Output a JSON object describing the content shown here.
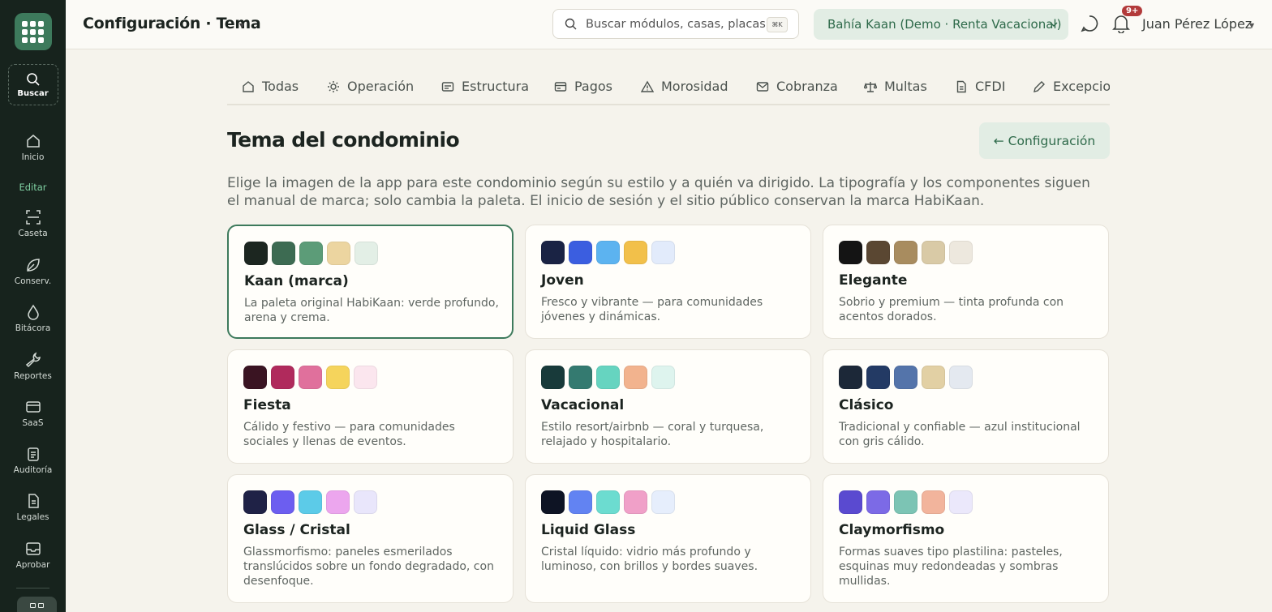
{
  "sidebar": {
    "search_label": "Buscar",
    "edit_label": "Editar",
    "items": [
      {
        "label": "Inicio",
        "icon": "home-icon"
      },
      {
        "label": "Caseta",
        "icon": "scan-icon"
      },
      {
        "label": "Conserv.",
        "icon": "leaf-icon"
      },
      {
        "label": "Bitácora",
        "icon": "drop-icon"
      },
      {
        "label": "Reportes",
        "icon": "wrench-icon"
      },
      {
        "label": "SaaS",
        "icon": "card-icon"
      },
      {
        "label": "Auditoría",
        "icon": "clipboard-icon"
      },
      {
        "label": "Legales",
        "icon": "document-icon"
      },
      {
        "label": "Aprobar",
        "icon": "inbox-icon"
      }
    ]
  },
  "header": {
    "title": "Configuración · Tema",
    "search_placeholder": "Buscar módulos, casas, placas…",
    "search_shortcut": "⌘K",
    "org_name": "Bahía Kaan (Demo · Renta Vacacional)",
    "notifications_badge": "9+",
    "user_name": "Juan Pérez López"
  },
  "tabs": [
    {
      "label": "Todas",
      "icon": "home-icon"
    },
    {
      "label": "Operación",
      "icon": "sun-icon"
    },
    {
      "label": "Estructura",
      "icon": "id-card-icon"
    },
    {
      "label": "Pagos",
      "icon": "card-icon"
    },
    {
      "label": "Morosidad",
      "icon": "warning-icon"
    },
    {
      "label": "Cobranza",
      "icon": "mail-icon"
    },
    {
      "label": "Multas",
      "icon": "scale-icon"
    },
    {
      "label": "CFDI",
      "icon": "file-icon"
    },
    {
      "label": "Excepcio",
      "icon": "pencil-icon"
    }
  ],
  "main": {
    "title": "Tema del condominio",
    "back_button": "← Configuración",
    "description": "Elige la imagen de la app para este condominio según su estilo y a quién va dirigido. La tipografía y los componentes siguen el manual de marca; solo cambia la paleta. El inicio de sesión y el sitio público conservan la marca HabiKaan."
  },
  "themes": [
    {
      "name": "Kaan (marca)",
      "description": "La paleta original HabiKaan: verde profundo, arena y crema.",
      "selected": true,
      "colors": [
        "#1c2620",
        "#3d6b52",
        "#5c9c78",
        "#ecd5a0",
        "#e3efe6"
      ]
    },
    {
      "name": "Joven",
      "description": "Fresco y vibrante — para comunidades jóvenes y dinámicas.",
      "selected": false,
      "colors": [
        "#1a2344",
        "#3b5ee0",
        "#5cb3f0",
        "#f2c04a",
        "#e2ebfb"
      ]
    },
    {
      "name": "Elegante",
      "description": "Sobrio y premium — tinta profunda con acentos dorados.",
      "selected": false,
      "colors": [
        "#141414",
        "#5a4732",
        "#a88c5f",
        "#d9caa6",
        "#ede8de"
      ]
    },
    {
      "name": "Fiesta",
      "description": "Cálido y festivo — para comunidades sociales y llenas de eventos.",
      "selected": false,
      "colors": [
        "#3a1422",
        "#b02a5c",
        "#e0709c",
        "#f5d45c",
        "#fbe6ee"
      ]
    },
    {
      "name": "Vacacional",
      "description": "Estilo resort/airbnb — coral y turquesa, relajado y hospitalario.",
      "selected": false,
      "colors": [
        "#183a3a",
        "#347a70",
        "#66d4c0",
        "#f2b38e",
        "#def4ee"
      ]
    },
    {
      "name": "Clásico",
      "description": "Tradicional y confiable — azul institucional con gris cálido.",
      "selected": false,
      "colors": [
        "#1c2838",
        "#233a64",
        "#5474aa",
        "#e2d0a4",
        "#e4e9f0"
      ]
    },
    {
      "name": "Glass / Cristal",
      "description": "Glassmorfismo: paneles esmerilados translúcidos sobre un fondo degradado, con desenfoque.",
      "selected": false,
      "colors": [
        "#1f2246",
        "#6c5ef0",
        "#5ccbe8",
        "#eca6ee",
        "#e9e6fb"
      ]
    },
    {
      "name": "Liquid Glass",
      "description": "Cristal líquido: vidrio más profundo y luminoso, con brillos y bordes suaves.",
      "selected": false,
      "colors": [
        "#0e1424",
        "#6283f2",
        "#6cdcd0",
        "#f0a0c8",
        "#e6eefc"
      ]
    },
    {
      "name": "Claymorfismo",
      "description": "Formas suaves tipo plastilina: pasteles, esquinas muy redondeadas y sombras mullidas.",
      "selected": false,
      "colors": [
        "#5a4ad0",
        "#7c6ae6",
        "#7cc4b4",
        "#f2b49c",
        "#ebe8fb"
      ]
    }
  ]
}
